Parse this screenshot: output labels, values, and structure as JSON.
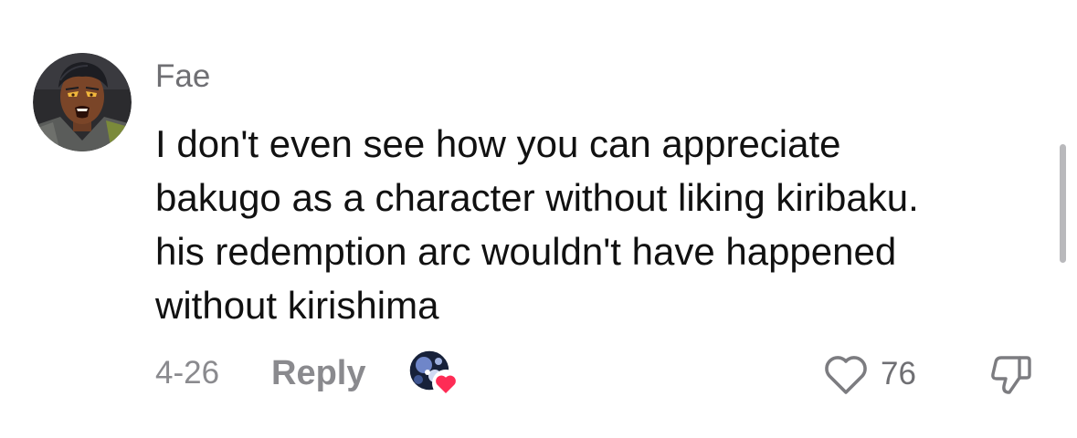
{
  "comment": {
    "username": "Fae",
    "text_lines": [
      "I don't even see how you can appreciate",
      "bakugo as a character without liking kiribaku.",
      "his redemption arc wouldn't have happened",
      "without kirishima"
    ],
    "date": "4-26",
    "reply_label": "Reply",
    "like_count": "76"
  },
  "icons": {
    "avatar": "avatar-image",
    "creator_liked": "creator-liked-icon",
    "like": "heart-outline-icon",
    "dislike": "thumbs-down-icon"
  },
  "colors": {
    "username": "#6f6f73",
    "text": "#111111",
    "meta": "#8a8a8e",
    "heart_badge": "#fe2c55"
  }
}
